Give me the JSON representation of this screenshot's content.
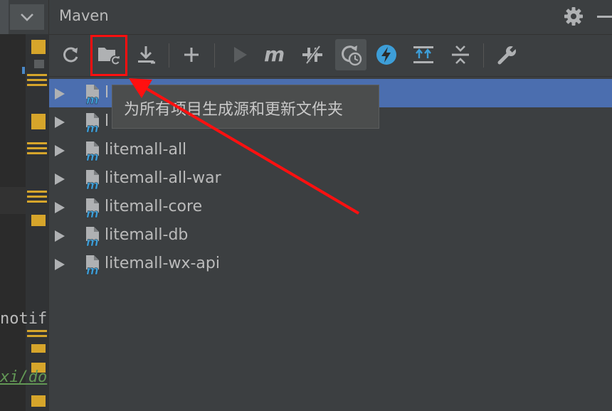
{
  "panel": {
    "title": "Maven"
  },
  "toolbar": {
    "items": [
      {
        "name": "reload-all-maven-projects",
        "icon": "refresh-icon"
      },
      {
        "name": "generate-sources-and-update-folders",
        "icon": "folder-refresh-icon"
      },
      {
        "name": "download-sources",
        "icon": "download-icon"
      },
      {
        "name": "add-maven-project",
        "icon": "plus-icon"
      },
      {
        "name": "run-maven-build",
        "icon": "play-icon"
      },
      {
        "name": "execute-maven-goal",
        "icon": "maven-m-icon"
      },
      {
        "name": "toggle-skip-tests",
        "icon": "skip-tests-icon"
      },
      {
        "name": "toggle-offline-mode",
        "icon": "offline-clock-icon"
      },
      {
        "name": "show-dependencies",
        "icon": "lightning-icon"
      },
      {
        "name": "expand-all",
        "icon": "expand-all-icon"
      },
      {
        "name": "collapse-all",
        "icon": "collapse-all-icon"
      },
      {
        "name": "maven-settings",
        "icon": "wrench-icon"
      }
    ]
  },
  "tooltip": {
    "text": "为所有项目生成源和更新文件夹"
  },
  "tree": {
    "items": [
      {
        "label": "l",
        "selected": true
      },
      {
        "label": "l",
        "selected": false
      },
      {
        "label": "litemall-all",
        "selected": false
      },
      {
        "label": "litemall-all-war",
        "selected": false
      },
      {
        "label": "litemall-core",
        "selected": false
      },
      {
        "label": "litemall-db",
        "selected": false
      },
      {
        "label": "litemall-wx-api",
        "selected": false
      }
    ]
  },
  "editor": {
    "code_line_1": "notif",
    "code_line_2": "xi/do"
  },
  "colors": {
    "selection": "#4b6eaf",
    "highlight_annotation": "#ff1010",
    "maven_blue": "#3d9ed8",
    "gutter_marker": "#d6a52b"
  }
}
